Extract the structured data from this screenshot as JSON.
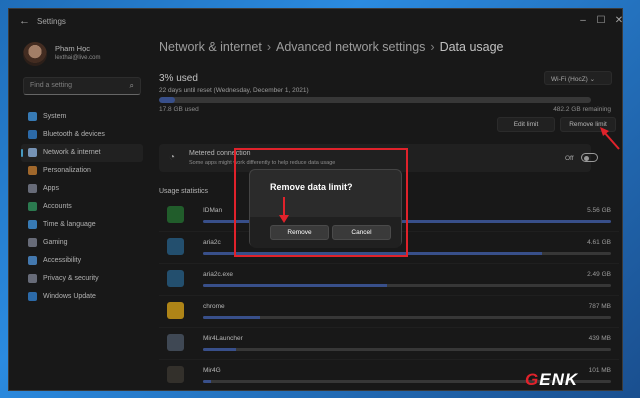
{
  "window": {
    "title": "Settings"
  },
  "profile": {
    "name": "Pham Học",
    "email": "lexthai@live.com"
  },
  "search": {
    "placeholder": "Find a setting"
  },
  "nav": [
    {
      "label": "System",
      "icon": "system-icon",
      "color": "#4aa3f0"
    },
    {
      "label": "Bluetooth & devices",
      "icon": "bluetooth-icon",
      "color": "#3b8ee0"
    },
    {
      "label": "Network & internet",
      "icon": "network-icon",
      "color": "#9ec4f2",
      "active": true
    },
    {
      "label": "Personalization",
      "icon": "brush-icon",
      "color": "#d68a3a"
    },
    {
      "label": "Apps",
      "icon": "apps-icon",
      "color": "#8a8fa0"
    },
    {
      "label": "Accounts",
      "icon": "accounts-icon",
      "color": "#3aa36a"
    },
    {
      "label": "Time & language",
      "icon": "clock-icon",
      "color": "#4aa3f0"
    },
    {
      "label": "Gaming",
      "icon": "gaming-icon",
      "color": "#8a8fa0"
    },
    {
      "label": "Accessibility",
      "icon": "accessibility-icon",
      "color": "#5aa0e8"
    },
    {
      "label": "Privacy & security",
      "icon": "shield-icon",
      "color": "#8a8fa0"
    },
    {
      "label": "Windows Update",
      "icon": "update-icon",
      "color": "#3b8ee0"
    }
  ],
  "breadcrumb": {
    "a": "Network & internet",
    "b": "Advanced network settings",
    "c": "Data usage",
    "sep": "›"
  },
  "usage": {
    "used": "3% used",
    "reset": "22 days until reset (Wednesday, December 1, 2021)",
    "used_amount": "17.8 GB used",
    "remaining": "482.2 GB remaining",
    "fraction": 0.036
  },
  "network_select": {
    "value": "Wi-Fi (HocZ)"
  },
  "buttons": {
    "edit_limit": "Edit limit",
    "remove_limit": "Remove limit"
  },
  "metered": {
    "title": "Metered connection",
    "subtitle": "Some apps might work differently to help reduce data usage",
    "state": "Off"
  },
  "usage_stats_title": "Usage statistics",
  "apps": [
    {
      "name": "IDMan",
      "size": "5.56 GB",
      "fraction": 1.0,
      "icon": "idm-icon",
      "color": "#2d7d3a"
    },
    {
      "name": "aria2c",
      "size": "4.61 GB",
      "fraction": 0.83,
      "icon": "aria2c-icon",
      "color": "#2f6a93"
    },
    {
      "name": "aria2c.exe",
      "size": "2.49 GB",
      "fraction": 0.45,
      "icon": "aria2c-exe-icon",
      "color": "#2f6a93"
    },
    {
      "name": "chrome",
      "size": "787 MB",
      "fraction": 0.14,
      "icon": "chrome-icon",
      "color": "#e8b01f"
    },
    {
      "name": "Mir4Launcher",
      "size": "439 MB",
      "fraction": 0.08,
      "icon": "mir4launcher-icon",
      "color": "#556070"
    },
    {
      "name": "Mir4G",
      "size": "101 MB",
      "fraction": 0.02,
      "icon": "mir4g-icon",
      "color": "#44403a"
    }
  ],
  "dialog": {
    "title": "Remove data limit?",
    "remove": "Remove",
    "cancel": "Cancel"
  },
  "watermark": "GENK",
  "accent": "#60cdff",
  "annotation_color": "#e0222b"
}
